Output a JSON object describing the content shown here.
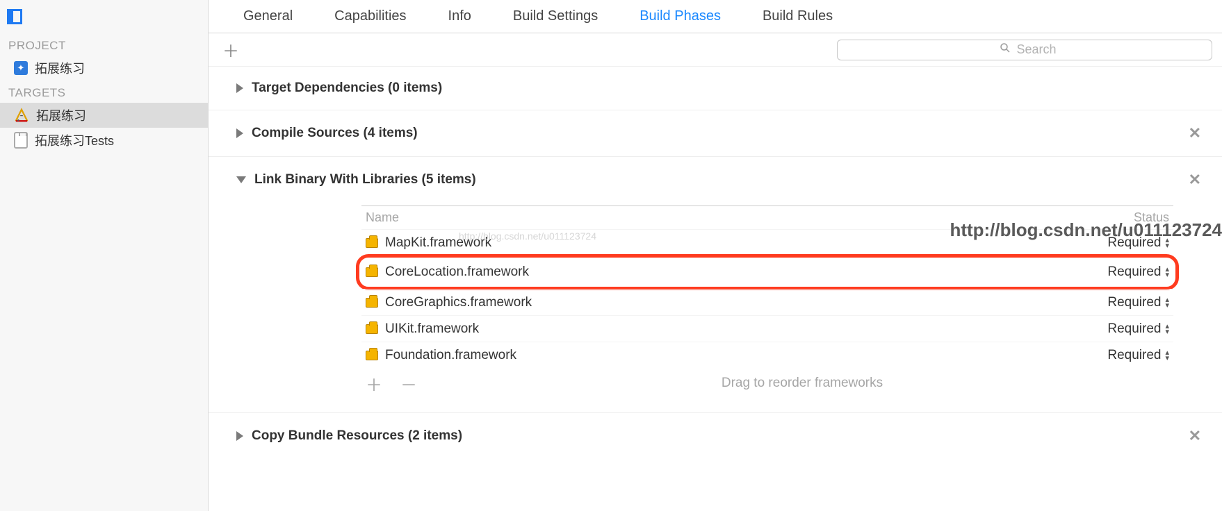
{
  "sidebar": {
    "section_project": "PROJECT",
    "section_targets": "TARGETS",
    "project_item": "拓展练习",
    "targets": [
      {
        "label": "拓展练习",
        "selected": true
      },
      {
        "label": "拓展练习Tests",
        "selected": false
      }
    ]
  },
  "tabs": [
    {
      "label": "General",
      "active": false
    },
    {
      "label": "Capabilities",
      "active": false
    },
    {
      "label": "Info",
      "active": false
    },
    {
      "label": "Build Settings",
      "active": false
    },
    {
      "label": "Build Phases",
      "active": true
    },
    {
      "label": "Build Rules",
      "active": false
    }
  ],
  "search": {
    "placeholder": "Search"
  },
  "phases": {
    "target_deps": {
      "title": "Target Dependencies (0 items)"
    },
    "compile_sources": {
      "title": "Compile Sources (4 items)"
    },
    "link_binary": {
      "title": "Link Binary With Libraries (5 items)",
      "col_name": "Name",
      "col_status": "Status",
      "rows": [
        {
          "name": "MapKit.framework",
          "status": "Required",
          "highlight": false
        },
        {
          "name": "CoreLocation.framework",
          "status": "Required",
          "highlight": true
        },
        {
          "name": "CoreGraphics.framework",
          "status": "Required",
          "highlight": false
        },
        {
          "name": "UIKit.framework",
          "status": "Required",
          "highlight": false
        },
        {
          "name": "Foundation.framework",
          "status": "Required",
          "highlight": false
        }
      ],
      "hint": "Drag to reorder frameworks"
    },
    "copy_bundle": {
      "title": "Copy Bundle Resources (2 items)"
    }
  },
  "watermark": "http://blog.csdn.net/u011123724",
  "faint_wm": "http://blog.csdn.net/u011123724"
}
